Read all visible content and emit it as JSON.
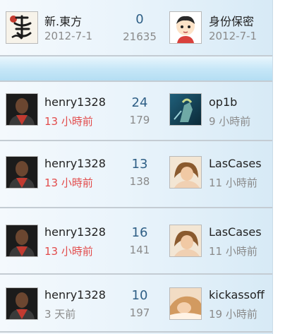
{
  "rows": [
    {
      "left_user": "新.東方",
      "left_time": "2012-7-1",
      "left_time_color": "#8a8a8a",
      "replies": "0",
      "views": "21635",
      "right_user": "身份保密",
      "right_time": "2012-7-1",
      "left_avatar": "calligraphy-avatar",
      "right_avatar": "cartoon-boy-avatar"
    },
    {
      "left_user": "henry1328",
      "left_time": "13 小時前",
      "left_time_color": "#e24b4b",
      "replies": "24",
      "views": "179",
      "right_user": "op1b",
      "right_time": "9 小時前",
      "left_avatar": "man-red-jacket-avatar",
      "right_avatar": "warrior-figure-avatar"
    },
    {
      "left_user": "henry1328",
      "left_time": "13 小時前",
      "left_time_color": "#e24b4b",
      "replies": "13",
      "views": "138",
      "right_user": "LasCases",
      "right_time": "11 小時前",
      "left_avatar": "man-red-jacket-avatar",
      "right_avatar": "woman-photo-avatar"
    },
    {
      "left_user": "henry1328",
      "left_time": "13 小時前",
      "left_time_color": "#e24b4b",
      "replies": "16",
      "views": "141",
      "right_user": "LasCases",
      "right_time": "11 小時前",
      "left_avatar": "man-red-jacket-avatar",
      "right_avatar": "woman-photo-avatar"
    },
    {
      "left_user": "henry1328",
      "left_time": "3 天前",
      "left_time_color": "#8a8a8a",
      "replies": "10",
      "views": "197",
      "right_user": "kickassoff",
      "right_time": "19 小時前",
      "left_avatar": "man-red-jacket-avatar",
      "right_avatar": "woman-lying-avatar"
    }
  ],
  "colors": {
    "name": "#222222",
    "muted": "#8a8a8a",
    "recent": "#e24b4b",
    "count": "#2f5f86",
    "accent_bar": "#c5e6f7"
  }
}
